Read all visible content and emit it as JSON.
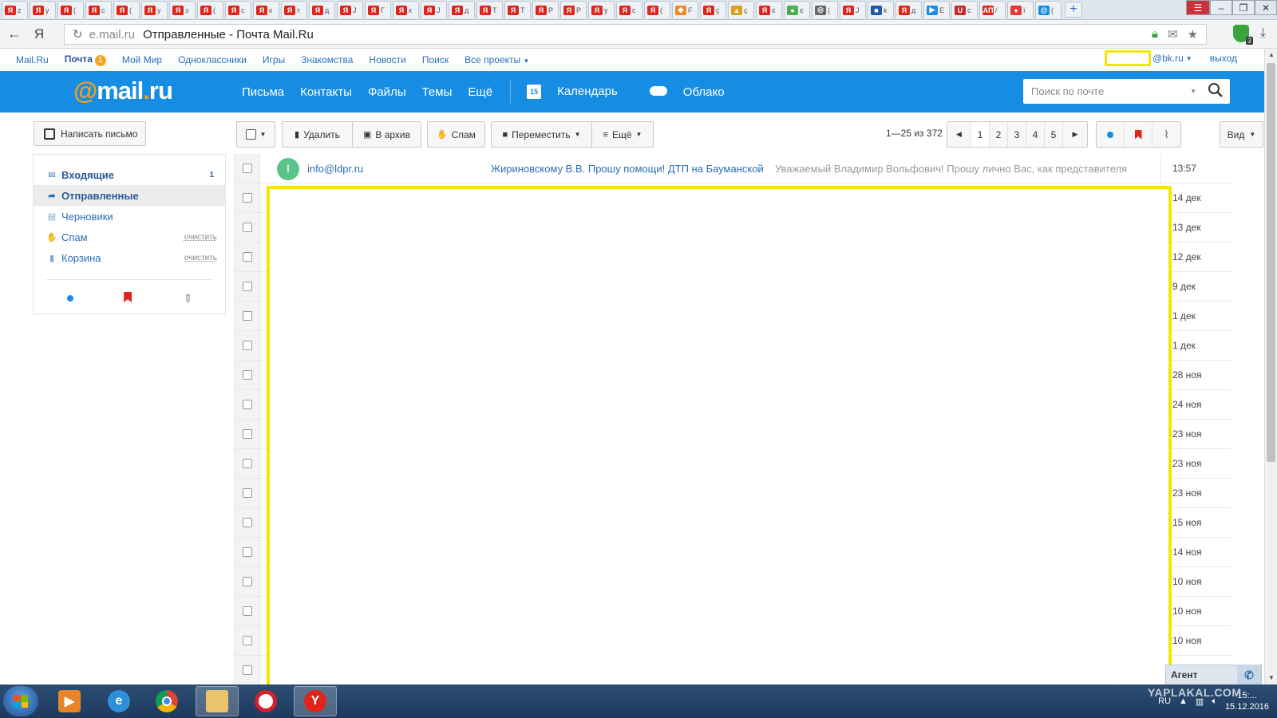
{
  "browser": {
    "tabs": [
      {
        "icon": "Я",
        "color": "#e0241b",
        "label": "z"
      },
      {
        "icon": "Я",
        "color": "#e0241b",
        "label": "у"
      },
      {
        "icon": "Я",
        "color": "#e0241b",
        "label": "("
      },
      {
        "icon": "Я",
        "color": "#e0241b",
        "label": "с"
      },
      {
        "icon": "Я",
        "color": "#e0241b",
        "label": "("
      },
      {
        "icon": "Я",
        "color": "#e0241b",
        "label": "у"
      },
      {
        "icon": "Я",
        "color": "#e0241b",
        "label": "з"
      },
      {
        "icon": "Я",
        "color": "#e0241b",
        "label": "("
      },
      {
        "icon": "Я",
        "color": "#e0241b",
        "label": "с"
      },
      {
        "icon": "Я",
        "color": "#e0241b",
        "label": "к"
      },
      {
        "icon": "Я",
        "color": "#e0241b",
        "label": "т"
      },
      {
        "icon": "Я",
        "color": "#e0241b",
        "label": "д"
      },
      {
        "icon": "Я",
        "color": "#e0241b",
        "label": "J"
      },
      {
        "icon": "Я",
        "color": "#e0241b",
        "label": "Г"
      },
      {
        "icon": "Я",
        "color": "#e0241b",
        "label": "к"
      },
      {
        "icon": "Я",
        "color": "#e0241b",
        "label": "J"
      },
      {
        "icon": "Я",
        "color": "#e0241b",
        "label": "д"
      },
      {
        "icon": "Я",
        "color": "#e0241b",
        "label": "Т"
      },
      {
        "icon": "Я",
        "color": "#e0241b",
        "label": "Т"
      },
      {
        "icon": "Я",
        "color": "#e0241b",
        "label": "Р"
      },
      {
        "icon": "Я",
        "color": "#e0241b",
        "label": "Р"
      },
      {
        "icon": "Я",
        "color": "#e0241b",
        "label": "у"
      },
      {
        "icon": "Я",
        "color": "#e0241b",
        "label": "с"
      },
      {
        "icon": "Я",
        "color": "#e0241b",
        "label": "("
      },
      {
        "icon": "◆",
        "color": "#f08a24",
        "label": "F"
      },
      {
        "icon": "Я",
        "color": "#e0241b",
        "label": "ç"
      },
      {
        "icon": "▲",
        "color": "#d9a21b",
        "label": "ç"
      },
      {
        "icon": "Я",
        "color": "#e0241b",
        "label": "є"
      },
      {
        "icon": "●",
        "color": "#4caf50",
        "label": "є"
      },
      {
        "icon": "◎",
        "color": "#666666",
        "label": "("
      },
      {
        "icon": "Я",
        "color": "#e0241b",
        "label": "J"
      },
      {
        "icon": "■",
        "color": "#1e5aa8",
        "label": "k"
      },
      {
        "icon": "Я",
        "color": "#e0241b",
        "label": "д"
      },
      {
        "icon": "▶",
        "color": "#1e88e5",
        "label": "E"
      },
      {
        "icon": "U",
        "color": "#c62828",
        "label": "с"
      },
      {
        "icon": "АП",
        "color": "#e0241b",
        "label": "/"
      },
      {
        "icon": "♦",
        "color": "#e53935",
        "label": "ї"
      },
      {
        "icon": "@",
        "color": "#168de2",
        "label": "("
      }
    ],
    "url_host": "e.mail.ru",
    "url_title": "Отправленные - Почта Mail.Ru",
    "shield_badge": "3"
  },
  "portal": {
    "links": [
      "Mail.Ru",
      "Почта",
      "Мой Мир",
      "Одноклассники",
      "Игры",
      "Знакомства",
      "Новости",
      "Поиск",
      "Все проекты"
    ],
    "mail_badge": "1",
    "domain": "@bk.ru",
    "logout": "выход"
  },
  "header": {
    "logo_at": "@",
    "logo_text": "mail",
    "logo_dot": ".",
    "logo_tld": "ru",
    "nav": [
      "Письма",
      "Контакты",
      "Файлы",
      "Темы",
      "Ещё"
    ],
    "calendar_day": "15",
    "calendar": "Календарь",
    "cloud": "Облако",
    "search_placeholder": "Поиск по почте"
  },
  "sidebar": {
    "compose": "Написать письмо",
    "folders": [
      {
        "label": "Входящие",
        "count": "1",
        "clear": "",
        "icon": "✉"
      },
      {
        "label": "Отправленные",
        "count": "",
        "clear": "",
        "icon": "➦"
      },
      {
        "label": "Черновики",
        "count": "",
        "clear": "",
        "icon": "▤"
      },
      {
        "label": "Спам",
        "count": "",
        "clear": "очистить",
        "icon": "✋"
      },
      {
        "label": "Корзина",
        "count": "",
        "clear": "очистить",
        "icon": "▮"
      }
    ]
  },
  "toolbar": {
    "delete": "Удалить",
    "archive": "В архив",
    "spam": "Спам",
    "move": "Переместить",
    "more": "Ещё",
    "pager_text": "1—25 из 372",
    "pages": [
      "1",
      "2",
      "3",
      "4",
      "5"
    ],
    "view": "Вид"
  },
  "messages": {
    "first": {
      "avatar": "I",
      "from": "info@ldpr.ru",
      "subject": "Жириновскому В.В. Прошу помощи! ДТП на Бауманской",
      "snippet": "Уважаемый Владимир Вольфович! Прошу лично Вас, как представителя",
      "date": "13:57"
    },
    "dates": [
      "14 дек",
      "13 дек",
      "12 дек",
      "9 дек",
      "1 дек",
      "1 дек",
      "28 ноя",
      "24 ноя",
      "23 ноя",
      "23 ноя",
      "23 ноя",
      "15 ноя",
      "14 ноя",
      "10 ноя",
      "10 ноя",
      "10 ноя",
      ""
    ]
  },
  "agent": {
    "label": "Агент"
  },
  "taskbar": {
    "lang": "RU",
    "time": "15:...",
    "date": "15.12.2016",
    "watermark": "YAPLAKAL.COM"
  },
  "colors": {
    "brand_blue": "#168de2",
    "brand_orange": "#f59f1b",
    "link": "#2a6fb8",
    "redaction": "#f3e600"
  }
}
